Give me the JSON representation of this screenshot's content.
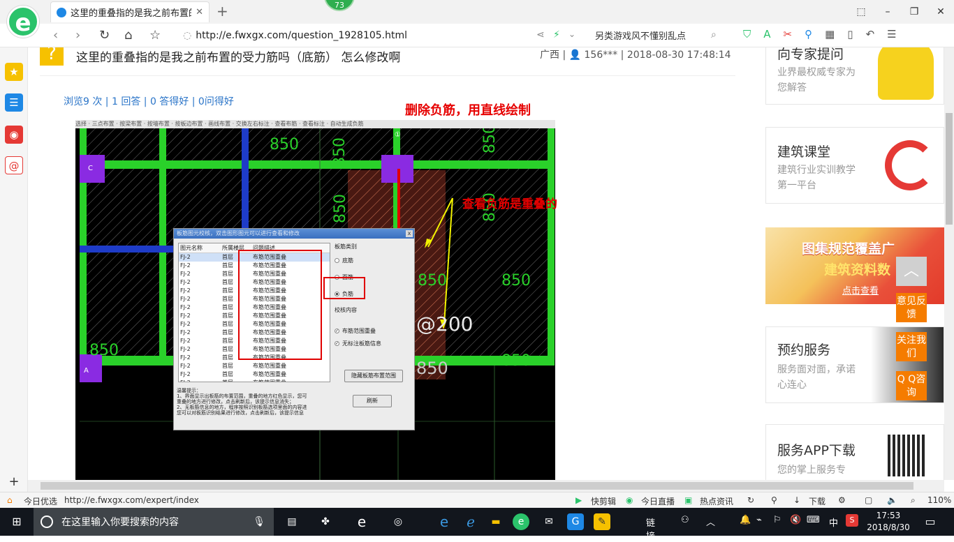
{
  "browser": {
    "logo_letter": "e",
    "tab_title": "这里的重叠指的是我之前布置的受力筋吗（底筋）",
    "tab_close": "✕",
    "new_tab": "+",
    "badge": "73",
    "url": "http://e.fwxgx.com/question_1928105.html",
    "search_hint": "另类游戏风不懂别乱点",
    "back": "‹",
    "forward": "›",
    "refresh": "↻",
    "home": "⌂",
    "star": "☆",
    "win_buttons": [
      "⬚",
      "–",
      "❐",
      "✕"
    ]
  },
  "question": {
    "icon": "?",
    "title": "这里的重叠指的是我之前布置的受力筋吗（底筋） 怎么修改啊",
    "meta": "广西 | 👤 156*** | 2018-08-30 17:48:14",
    "stats": "浏览9 次 | 1 回答 | 0 答得好 | 0问得好"
  },
  "annotations": {
    "delete_negative": "删除负筋，用直线绘制",
    "check_overlap": "查看负筋是重叠的"
  },
  "cad": {
    "toolbar": "选择 · 三点布置 · 按梁布置 · 按墙布置 · 按板边布置 · 画线布置 · 交换左右标注 · 查看布筋 · 查看标注 · 自动生成负筋",
    "labels": [
      "850",
      "850",
      "850",
      "850",
      "850",
      "850",
      "850",
      "850",
      "850",
      "@200",
      "850"
    ],
    "axis_c": "C",
    "axis_a": "A",
    "axis_top": "①"
  },
  "dialog": {
    "title": "板筋图元校核，双击图形图元可以进行查看和修改",
    "close": "x",
    "headers": [
      "图元名称",
      "所属楼层",
      "问题描述"
    ],
    "row_name": "FJ-2",
    "row_floor": "首层",
    "row_issue": "布筋范围重叠",
    "row_count": 16,
    "category_label": "板筋类别",
    "options": [
      "底筋",
      "面筋",
      "负筋"
    ],
    "selected_option": "负筋",
    "check_label": "校核内容",
    "checks": [
      "布筋范围重叠",
      "无标注板筋信息"
    ],
    "btn_hide": "隐藏板筋布置范围",
    "btn_refresh": "刷新",
    "tips": [
      "温馨提示：",
      "1、界面显示出板筋的布置范围，重叠的地方红色显示，您可",
      "重叠的地方进行修改，点击刷新后，该提示信息消失；",
      "2、无板筋信息的地方，程序按照识别板筋选项里面的内容进",
      "您可以对板筋识别结果进行修改，点击刷新后，该提示信息"
    ]
  },
  "sidebar": {
    "cards": [
      {
        "title": "向专家提问",
        "sub": "业界最权威专家为您解答"
      },
      {
        "title": "建筑课堂",
        "sub": "建筑行业实训教学第一平台"
      },
      {
        "title": "预约服务",
        "sub": "服务面对面，承诺心连心"
      },
      {
        "title": "服务APP下载",
        "sub": "您的掌上服务专"
      }
    ],
    "banner": {
      "line1": "图集规范覆盖广",
      "line2": "建筑资料数",
      "line3": "点击查看"
    },
    "float": {
      "top": "︿",
      "feedback": "意见反馈",
      "follow": "关注我们",
      "qq": "Q Q咨询"
    }
  },
  "statusbar": {
    "today": "今日优选",
    "hover_url": "http://e.fwxgx.com/expert/index",
    "items": [
      "快剪辑",
      "今日直播",
      "热点资讯",
      "下载"
    ],
    "zoom": "110%"
  },
  "taskbar": {
    "search_placeholder": "在这里输入你要搜索的内容",
    "tray_link": "链接",
    "ime": "中",
    "time": "17:53",
    "date": "2018/8/30"
  },
  "colors": {
    "link_blue": "#2a74c8",
    "annotation_red": "#e60000",
    "cad_green": "#2ad12a",
    "accent_orange": "#f57c00"
  }
}
